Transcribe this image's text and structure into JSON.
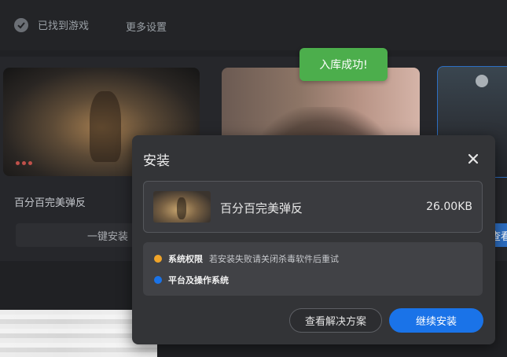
{
  "topbar": {
    "found_label": "已找到游戏",
    "more_settings": "更多设置",
    "check_icon": "check-circle-icon"
  },
  "cards": [
    {
      "title": "百分百完美弹反",
      "button": "一键安装"
    },
    {
      "title": "",
      "button": ""
    },
    {
      "title": "",
      "button": "查看"
    }
  ],
  "toast": {
    "text": "入库成功!"
  },
  "dialog": {
    "title": "安装",
    "close_icon": "close-icon",
    "item": {
      "name": "百分百完美弹反",
      "size": "26.00KB"
    },
    "checks": [
      {
        "label": "系统权限",
        "message": "若安装失败请关闭杀毒软件后重试",
        "color": "#f0a429"
      },
      {
        "label": "平台及操作系统",
        "message": "",
        "color": "#1a73e8"
      }
    ],
    "buttons": {
      "solution": "查看解决方案",
      "continue": "继续安装"
    }
  },
  "colors": {
    "accent": "#1a73e8",
    "success": "#4cae4c",
    "warning": "#f0a429",
    "background": "#202124",
    "dialog": "#333437"
  }
}
